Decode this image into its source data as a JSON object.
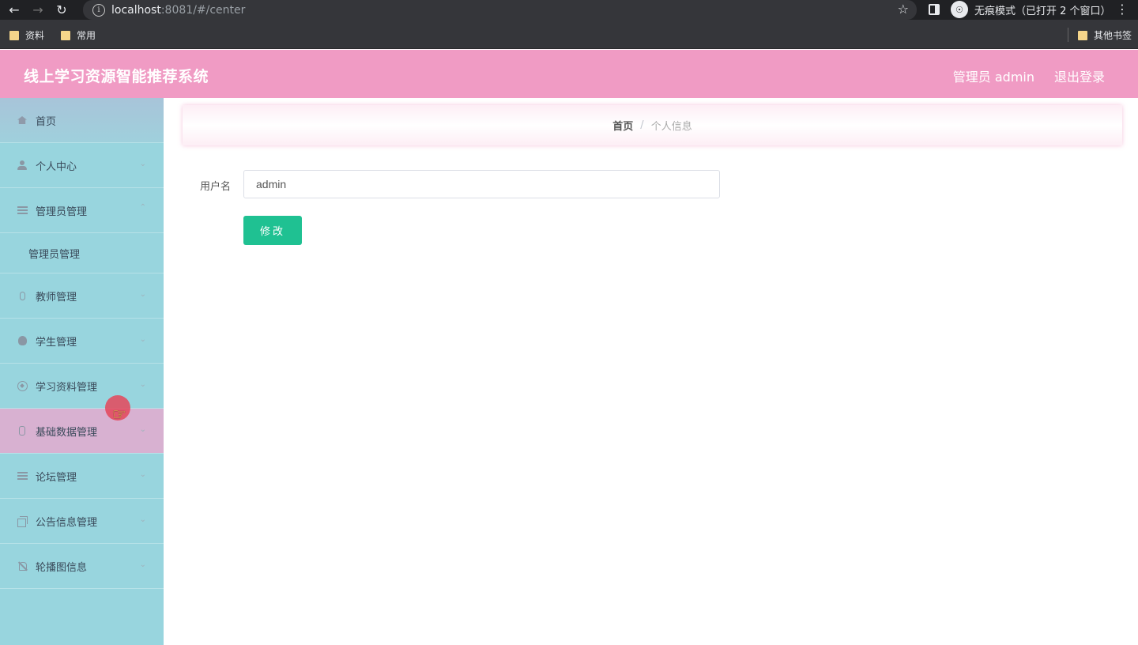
{
  "browser": {
    "url_host": "localhost",
    "url_rest": ":8081/#/center",
    "incognito_text": "无痕模式（已打开 2 个窗口）",
    "bookmarks": [
      {
        "label": "资料"
      },
      {
        "label": "常用"
      }
    ],
    "other_bookmarks": "其他书签"
  },
  "header": {
    "title": "线上学习资源智能推荐系统",
    "user": "管理员 admin",
    "logout": "退出登录"
  },
  "sidebar": {
    "items": [
      {
        "label": "首页",
        "icon": "home-icon"
      },
      {
        "label": "个人中心",
        "icon": "user-icon"
      },
      {
        "label": "管理员管理",
        "icon": "list-icon",
        "expanded": true,
        "children": [
          {
            "label": "管理员管理"
          }
        ]
      },
      {
        "label": "教师管理",
        "icon": "mic-icon"
      },
      {
        "label": "学生管理",
        "icon": "bulb-icon"
      },
      {
        "label": "学习资料管理",
        "icon": "compass-icon"
      },
      {
        "label": "基础数据管理",
        "icon": "data-icon"
      },
      {
        "label": "论坛管理",
        "icon": "list-icon"
      },
      {
        "label": "公告信息管理",
        "icon": "copy-icon"
      },
      {
        "label": "轮播图信息",
        "icon": "bell-off-icon"
      }
    ]
  },
  "breadcrumb": {
    "home": "首页",
    "separator": "/",
    "current": "个人信息"
  },
  "form": {
    "username_label": "用户名",
    "username_value": "admin",
    "submit_label": "修改"
  },
  "colors": {
    "header_bg": "#f09bc4",
    "sidebar_bg": "#98d5de",
    "sidebar_hover": "#d8b1d1",
    "button_bg": "#1fc192"
  }
}
